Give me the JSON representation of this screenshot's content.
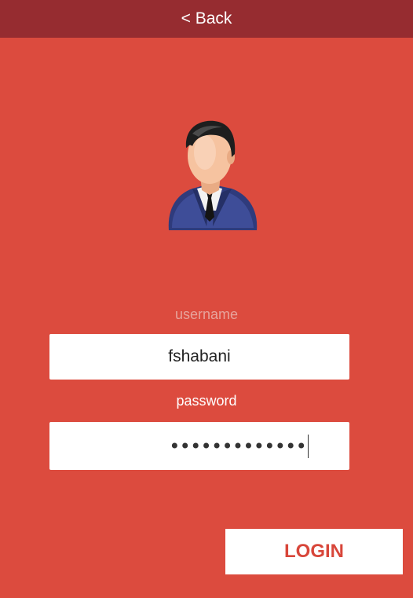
{
  "header": {
    "back_label": "< Back"
  },
  "avatar": {
    "icon": "user-businessman-icon"
  },
  "form": {
    "username_label": "username",
    "username_value": "fshabani",
    "password_label": "password",
    "password_masked": "•••••••••••••"
  },
  "actions": {
    "login_label": "LOGIN"
  },
  "colors": {
    "background": "#dc4b3e",
    "header": "#962c30",
    "accent": "#d8463a",
    "username_label": "#e7a39b"
  }
}
